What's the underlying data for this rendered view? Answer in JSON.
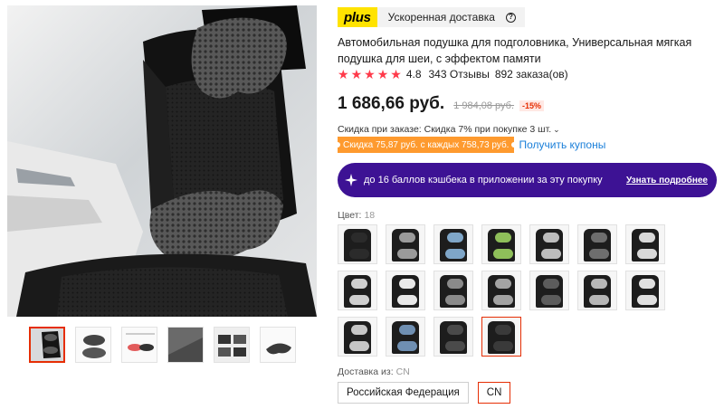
{
  "badge": {
    "plus": "plus",
    "text": "Ускоренная доставка",
    "help": "?"
  },
  "product": {
    "title": "Автомобильная подушка для подголовника, Универсальная мягкая подушка для шеи, с эффектом памяти",
    "rating": {
      "stars": 5,
      "value": "4.8",
      "reviews": "343 Отзывы",
      "orders": "892 заказа(ов)"
    },
    "price": "1 686,66 руб.",
    "old_price": "1 984,08 руб.",
    "discount": "-15%"
  },
  "promo": {
    "order_discount": "Скидка при заказе: Скидка 7% при покупке 3 шт.",
    "coupon": "Скидка 75,87 руб. с каждых 758,73 руб.",
    "coupon_link": "Получить купоны"
  },
  "cashback": {
    "text": "до 16 баллов кэшбека в приложении за эту покупку",
    "link": "Узнать подробнее"
  },
  "colors": {
    "label": "Цвет:",
    "count": "18",
    "selected_index": 17,
    "swatches": [
      {
        "pillow": "#2b2b2b"
      },
      {
        "pillow": "#9a9a9a"
      },
      {
        "pillow": "#7fa6c8"
      },
      {
        "pillow": "#8fbf5a"
      },
      {
        "pillow": "#bdbdbd"
      },
      {
        "pillow": "#6e6e6e"
      },
      {
        "pillow": "#d8d8d8"
      },
      {
        "pillow": "#cfcfcf"
      },
      {
        "pillow": "#e8e8e8"
      },
      {
        "pillow": "#8a8a8a"
      },
      {
        "pillow": "#a3a3a3"
      },
      {
        "pillow": "#5c5c5c"
      },
      {
        "pillow": "#b7b7b7"
      },
      {
        "pillow": "#e0e0e0"
      },
      {
        "pillow": "#c6c6c6"
      },
      {
        "pillow": "#6f8fb2"
      },
      {
        "pillow": "#4a4a4a"
      },
      {
        "pillow": "#3a3a3a"
      }
    ]
  },
  "shipping": {
    "label": "Доставка из:",
    "from": "CN",
    "options": [
      "Российская Федерация",
      "CN"
    ],
    "selected_index": 1
  },
  "gallery": {
    "active_index": 0,
    "thumb_count": 6
  },
  "colors_theme": {
    "accent_red": "#e62e04",
    "plus_yellow": "#ffe300",
    "cashback_purple": "#3d1294",
    "link_blue": "#1a7fd9",
    "coupon_orange": "#fe9a2e"
  }
}
